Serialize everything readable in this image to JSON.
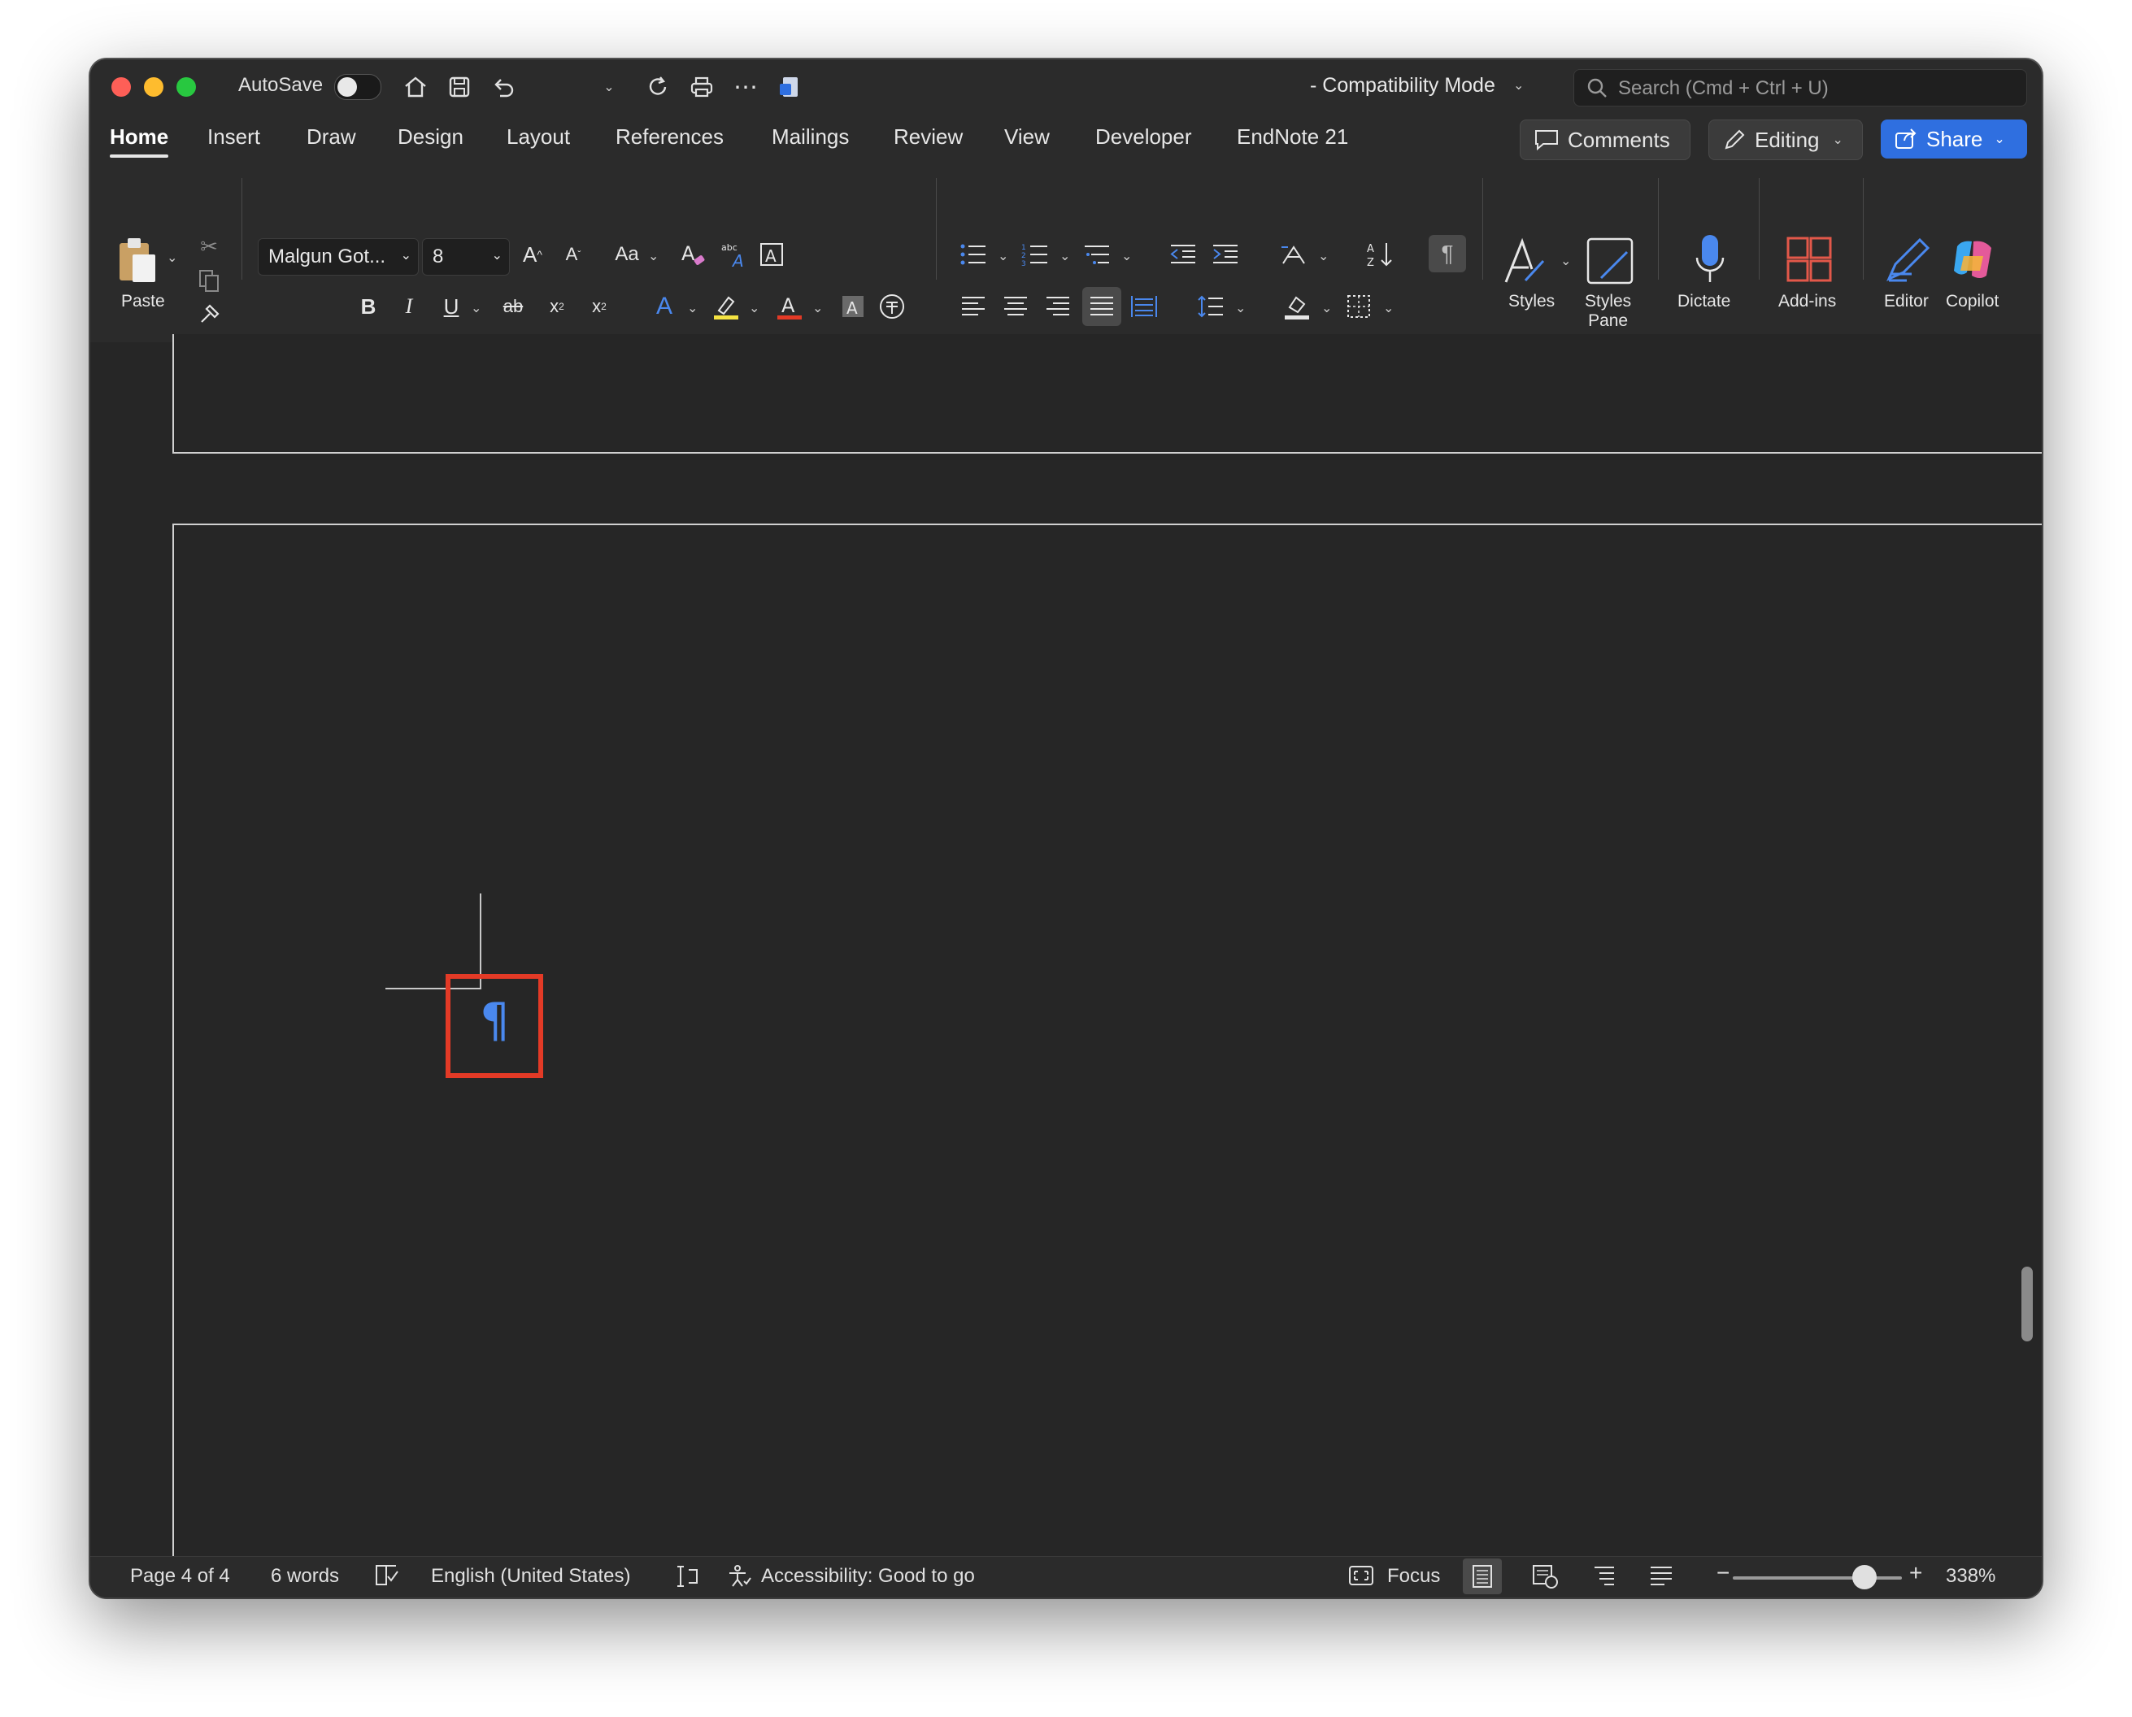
{
  "titlebar": {
    "autosave_label": "AutoSave",
    "doc_title": "-  Compatibility Mode",
    "search_placeholder": "Search (Cmd + Ctrl + U)"
  },
  "tabs": [
    "Home",
    "Insert",
    "Draw",
    "Design",
    "Layout",
    "References",
    "Mailings",
    "Review",
    "View",
    "Developer",
    "EndNote 21"
  ],
  "active_tab": "Home",
  "actions": {
    "comments": "Comments",
    "editing": "Editing",
    "share": "Share"
  },
  "ribbon": {
    "paste": "Paste",
    "font_name": "Malgun Got...",
    "font_size": "8",
    "styles": "Styles",
    "styles_pane_line1": "Styles",
    "styles_pane_line2": "Pane",
    "dictate": "Dictate",
    "addins": "Add-ins",
    "editor": "Editor",
    "copilot": "Copilot",
    "change_case": "Aa",
    "bold": "B",
    "italic": "I",
    "underline": "U",
    "strike": "ab",
    "subscript": "x",
    "superscript": "x",
    "show_marks": "¶"
  },
  "document": {
    "paragraph_mark": "¶"
  },
  "statusbar": {
    "page": "Page 4 of 4",
    "words": "6 words",
    "language": "English (United States)",
    "accessibility": "Accessibility: Good to go",
    "focus": "Focus",
    "zoom": "338%"
  },
  "colors": {
    "window_bg": "#262626",
    "share_blue": "#2f6fe0",
    "highlight_red": "#e33a26",
    "pilcrow_blue": "#4a88ee"
  }
}
